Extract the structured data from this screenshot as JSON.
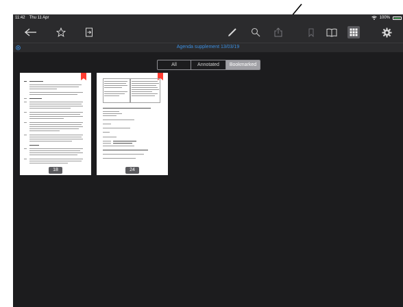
{
  "status_bar": {
    "time": "11:42",
    "date": "Thu 11 Apr",
    "battery_percent_label": "100%",
    "battery_level": 1.0
  },
  "toolbar": {
    "icons": [
      "back-arrow-icon",
      "star-icon",
      "export-icon",
      "pencil-icon",
      "search-icon",
      "share-icon",
      "bookmark-icon",
      "book-icon",
      "grid-icon",
      "gear-icon"
    ]
  },
  "document": {
    "title": "Agenda supplement 13/03/19"
  },
  "filter": {
    "options": [
      "All",
      "Annotated",
      "Bookmarked"
    ],
    "selected": "Bookmarked"
  },
  "pages": [
    {
      "number": "18",
      "bookmarked": true
    },
    {
      "number": "24",
      "bookmarked": true
    }
  ],
  "colors": {
    "screen_bg": "#1c1c1e",
    "bar_bg": "#2b2b2d",
    "accent_blue": "#3d8fe0",
    "bookmark_red": "#ff3b30",
    "battery_green": "#4cd964"
  }
}
